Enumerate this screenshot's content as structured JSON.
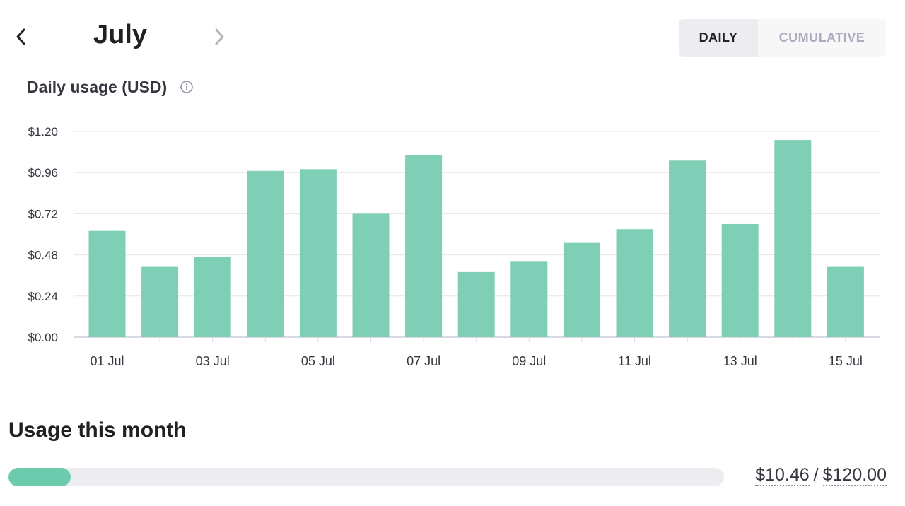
{
  "header": {
    "month": "July",
    "prev_icon": "chevron-left-icon",
    "next_icon": "chevron-right-icon",
    "toggle": {
      "daily_label": "DAILY",
      "cumulative_label": "CUMULATIVE",
      "selected": "DAILY"
    }
  },
  "chart_title": "Daily usage (USD)",
  "info_icon": "info-icon",
  "colors": {
    "bar": "#7fcfb6",
    "progress_fill": "#6ccbad",
    "track": "#ececf1",
    "grid": "#e5e5e5",
    "axis_text": "#353740"
  },
  "chart_data": {
    "type": "bar",
    "title": "Daily usage (USD)",
    "xlabel": "",
    "ylabel": "",
    "ylim": [
      0,
      1.2
    ],
    "grid": true,
    "legend": "none",
    "categories": [
      "01 Jul",
      "02 Jul",
      "03 Jul",
      "04 Jul",
      "05 Jul",
      "06 Jul",
      "07 Jul",
      "08 Jul",
      "09 Jul",
      "10 Jul",
      "11 Jul",
      "12 Jul",
      "13 Jul",
      "14 Jul",
      "15 Jul"
    ],
    "x_tick_labels": [
      "01 Jul",
      "03 Jul",
      "05 Jul",
      "07 Jul",
      "09 Jul",
      "11 Jul",
      "13 Jul",
      "15 Jul"
    ],
    "y_tick_labels": [
      "$0.00",
      "$0.24",
      "$0.48",
      "$0.72",
      "$0.96",
      "$1.20"
    ],
    "y_ticks": [
      0,
      0.24,
      0.48,
      0.72,
      0.96,
      1.2
    ],
    "values": [
      0.62,
      0.41,
      0.47,
      0.97,
      0.98,
      0.72,
      1.06,
      0.38,
      0.44,
      0.55,
      0.63,
      1.03,
      0.66,
      1.15,
      0.41
    ]
  },
  "usage": {
    "title": "Usage this month",
    "used": "$10.46",
    "separator": "/",
    "limit": "$120.00",
    "fraction": 0.0872
  }
}
